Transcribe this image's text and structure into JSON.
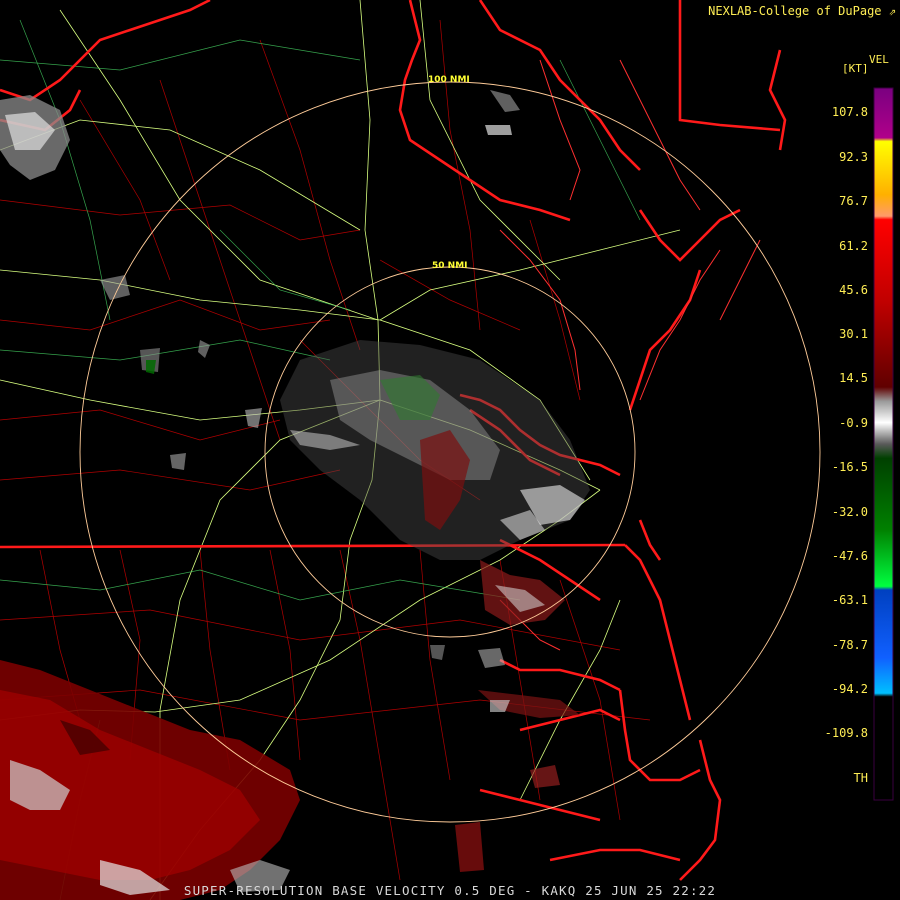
{
  "header": {
    "credit": "NEXLAB-College of DuPage",
    "credit_icon": "external-link-icon"
  },
  "footer": {
    "product_line": "SUPER-RESOLUTION BASE VELOCITY 0.5 DEG - KAKQ 25 JUN 25 22:22"
  },
  "legend": {
    "product": "VEL",
    "units": "[KT]",
    "labels": [
      "107.8",
      "92.3",
      "76.7",
      "61.2",
      "45.6",
      "30.1",
      "14.5",
      "-0.9",
      "-16.5",
      "-32.0",
      "-47.6",
      "-63.1",
      "-78.7",
      "-94.2",
      "-109.8",
      "TH"
    ],
    "colors": {
      "purple": "#8a0a8a",
      "yellow": "#ffff00",
      "orange": "#ff9a6a",
      "red": "#ff0000",
      "dark_red": "#600000",
      "gray": "#c8c8c8",
      "green": "#00b000",
      "bright_green": "#00ff40",
      "blue": "#1060ff",
      "cyan": "#00c0ff"
    }
  },
  "map": {
    "range_rings": [
      "50 NMI",
      "100 NMI"
    ],
    "colors": {
      "state_borders": "#ff1a1a",
      "county_borders": "#b00000",
      "highways": "#d8ff80",
      "range_rings": "#ffcc99"
    }
  }
}
